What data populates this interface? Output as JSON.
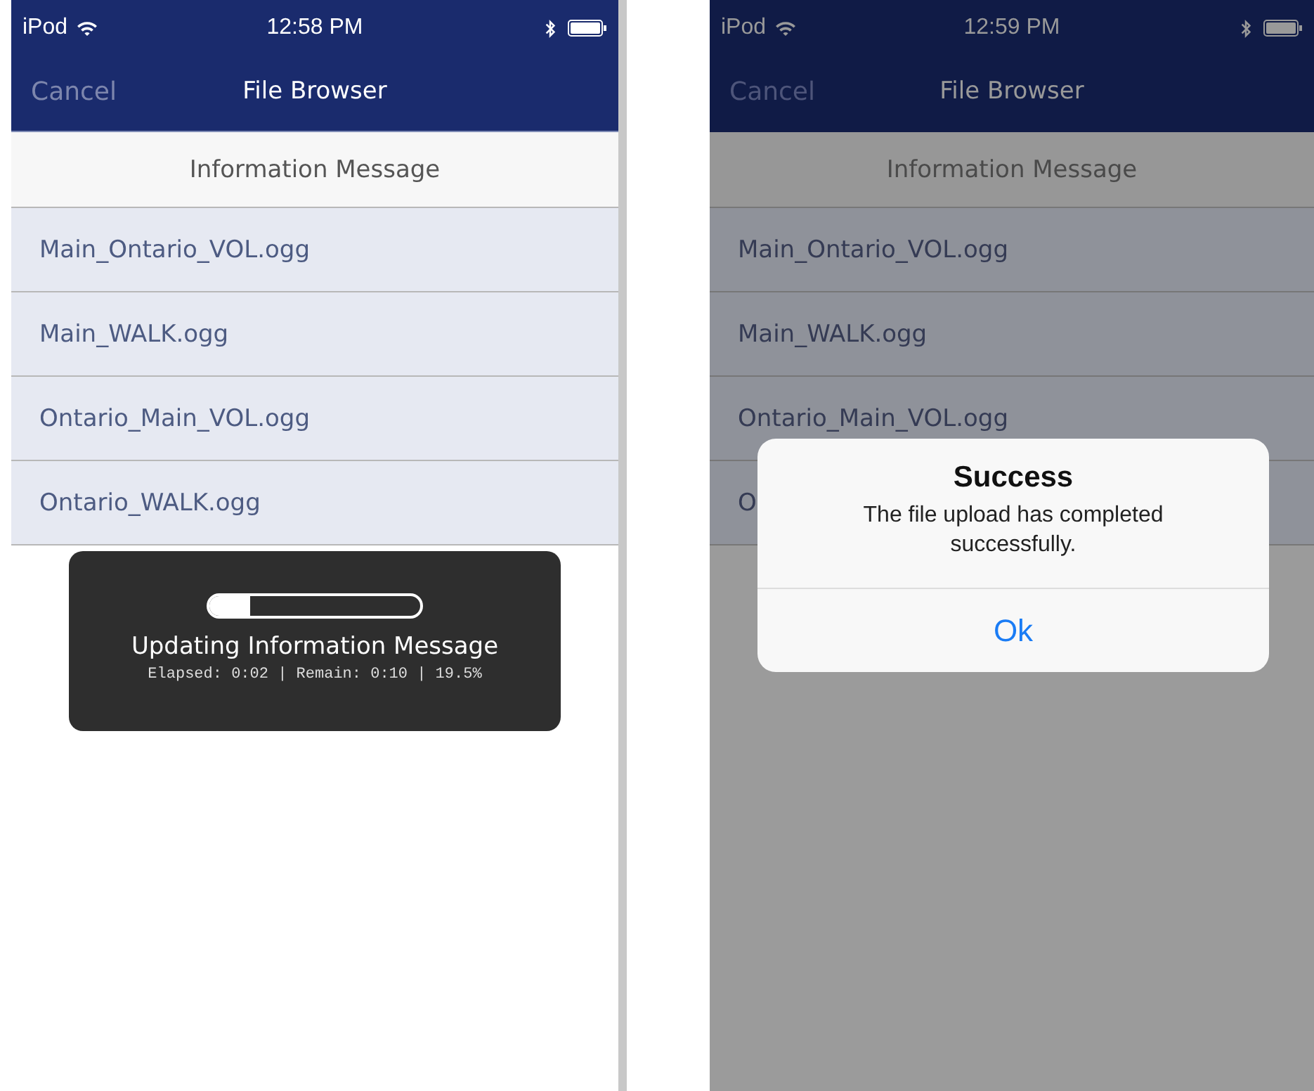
{
  "screens": [
    {
      "dimmed": false,
      "status_bar": {
        "carrier": "iPod",
        "time": "12:58 PM"
      },
      "nav_bar": {
        "left_button": "Cancel",
        "title": "File Browser"
      },
      "list_header": "Information Message",
      "files": [
        "Main_Ontario_VOL.ogg",
        "Main_WALK.ogg",
        "Ontario_Main_VOL.ogg",
        "Ontario_WALK.ogg"
      ],
      "progress_hud": {
        "level": 0.195,
        "title": "Updating Information Message",
        "detail": "Elapsed: 0:02 | Remain: 0:10 | 19.5%"
      }
    },
    {
      "dimmed": true,
      "status_bar": {
        "carrier": "iPod",
        "time": "12:59 PM"
      },
      "nav_bar": {
        "left_button": "Cancel",
        "title": "File Browser"
      },
      "list_header": "Information Message",
      "files": [
        "Main_Ontario_VOL.ogg",
        "Main_WALK.ogg",
        "Ontario_Main_VOL.ogg",
        "O"
      ],
      "alert": {
        "title": "Success",
        "message": "The file upload has completed successfully.",
        "buttons": [
          "Ok"
        ]
      }
    }
  ]
}
